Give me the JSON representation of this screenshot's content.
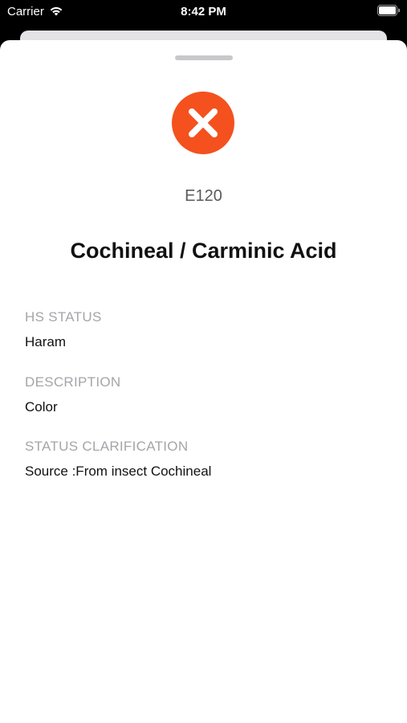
{
  "status_bar": {
    "carrier": "Carrier",
    "time": "8:42 PM",
    "wifi_icon": "wifi-icon",
    "battery_icon": "battery-icon"
  },
  "sheet": {
    "status_icon": "close-circle-icon",
    "status_color": "#f4511e",
    "code": "E120",
    "title": "Cochineal / Carminic Acid",
    "sections": [
      {
        "label": "HS STATUS",
        "value": "Haram"
      },
      {
        "label": "DESCRIPTION",
        "value": "Color"
      },
      {
        "label": "STATUS CLARIFICATION",
        "value": "Source :From insect Cochineal"
      }
    ]
  }
}
